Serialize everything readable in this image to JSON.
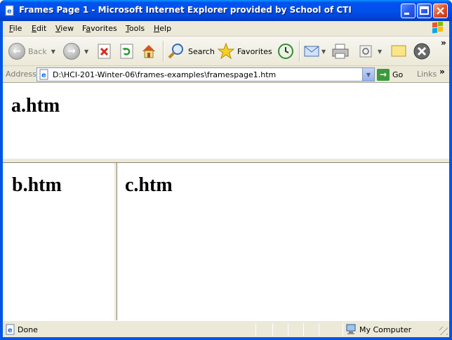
{
  "window": {
    "title": "Frames Page 1 - Microsoft Internet Explorer provided by School of CTI",
    "title_icon": "ie-page-icon",
    "controls": [
      "minimize-icon",
      "maximize-icon",
      "close-icon"
    ],
    "accent": "#0054e3"
  },
  "menu": {
    "items": [
      {
        "ul": "F",
        "rest": "ile"
      },
      {
        "ul": "E",
        "rest": "dit"
      },
      {
        "ul": "V",
        "rest": "iew"
      },
      {
        "pre": "F",
        "ul": "a",
        "rest": "vorites"
      },
      {
        "ul": "T",
        "rest": "ools"
      },
      {
        "ul": "H",
        "rest": "elp"
      }
    ],
    "logo_icon": "windows-logo-icon"
  },
  "toolbar": {
    "back_label": "Back",
    "search_label": "Search",
    "favorites_label": "Favorites",
    "icons": [
      "back-arrow-icon",
      "forward-arrow-icon",
      "stop-icon",
      "refresh-icon",
      "home-icon",
      "search-icon",
      "favorites-star-icon",
      "history-icon",
      "mail-icon",
      "print-icon",
      "edit-icon",
      "discuss-icon",
      "messenger-icon"
    ]
  },
  "address": {
    "label": "Address",
    "url": "D:\\HCI-201-Winter-06\\frames-examples\\framespage1.htm",
    "go_label": "Go",
    "links_label": "Links"
  },
  "frames": {
    "a": "a.htm",
    "b": "b.htm",
    "c": "c.htm"
  },
  "status": {
    "text": "Done",
    "zone": "My Computer"
  }
}
